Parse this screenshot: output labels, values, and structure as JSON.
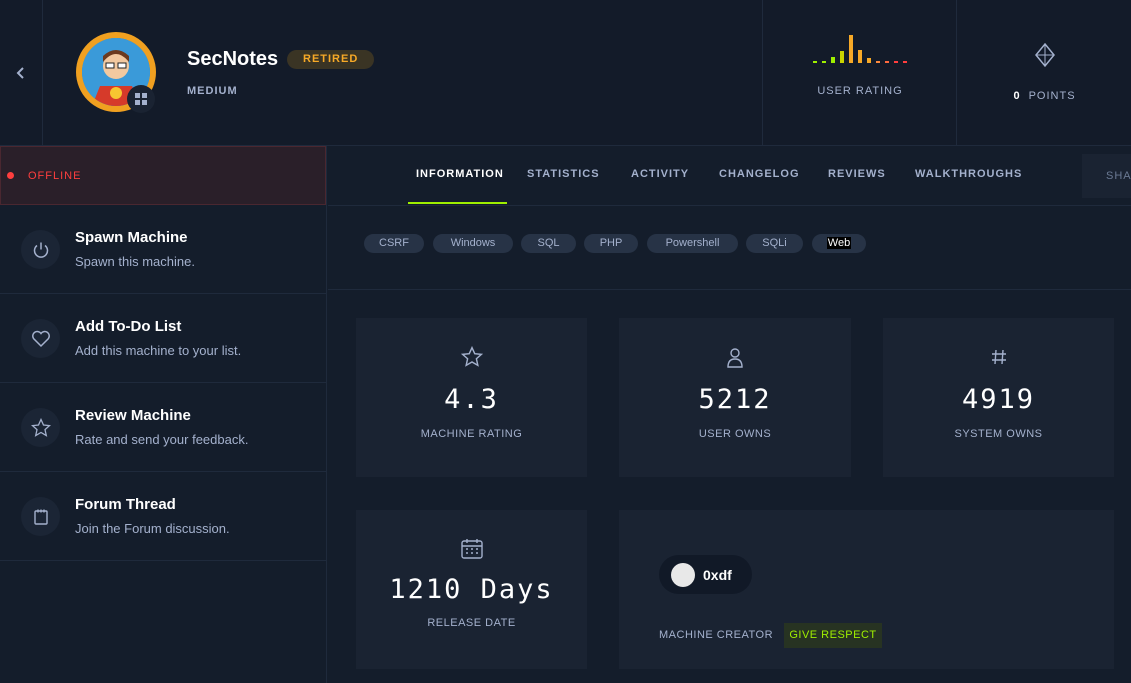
{
  "machine": {
    "name": "SecNotes",
    "status_badge": "RETIRED",
    "difficulty": "MEDIUM",
    "user_rating_label": "USER RATING",
    "points_value": "0",
    "points_label": "POINTS"
  },
  "sidebar": {
    "status": "OFFLINE",
    "items": [
      {
        "title": "Spawn Machine",
        "subtitle": "Spawn this machine.",
        "icon": "power-icon"
      },
      {
        "title": "Add To-Do List",
        "subtitle": "Add this machine to your list.",
        "icon": "heart-icon"
      },
      {
        "title": "Review Machine",
        "subtitle": "Rate and send your feedback.",
        "icon": "star-icon"
      },
      {
        "title": "Forum Thread",
        "subtitle": "Join the Forum discussion.",
        "icon": "forum-icon"
      }
    ]
  },
  "tabs": [
    "INFORMATION",
    "STATISTICS",
    "ACTIVITY",
    "CHANGELOG",
    "REVIEWS",
    "WALKTHROUGHS"
  ],
  "share_label": "SHA",
  "tags": [
    "CSRF",
    "Windows",
    "SQL",
    "PHP",
    "Powershell",
    "SQLi",
    "Web"
  ],
  "stats": {
    "rating": {
      "value": "4.3",
      "label": "MACHINE RATING"
    },
    "user_owns": {
      "value": "5212",
      "label": "USER OWNS"
    },
    "system_owns": {
      "value": "4919",
      "label": "SYSTEM OWNS"
    },
    "release": {
      "value": "1210 Days",
      "label": "RELEASE DATE"
    }
  },
  "creator": {
    "name": "0xdf",
    "label": "MACHINE CREATOR",
    "respect_label": "GIVE RESPECT"
  },
  "colors": {
    "accent_green": "#9fef00",
    "retired_orange": "#f7a927",
    "offline_red": "#ff3e3e"
  }
}
